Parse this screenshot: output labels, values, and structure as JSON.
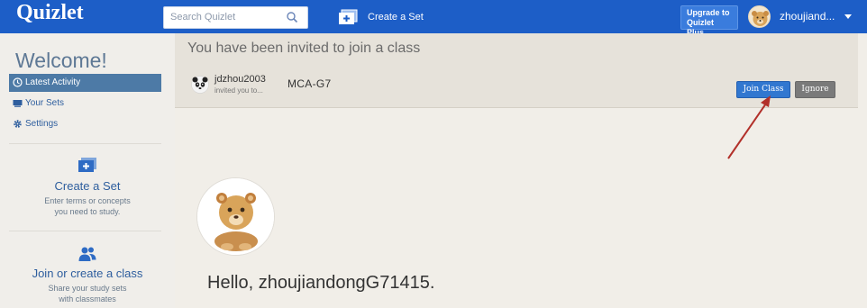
{
  "topbar": {
    "logo": "Quizlet",
    "search_placeholder": "Search Quizlet",
    "create_label": "Create a Set",
    "upgrade_line1": "Upgrade to",
    "upgrade_line2": "Quizlet Plus",
    "username": "zhoujiand...",
    "brand_color": "#1d5ec7"
  },
  "sidebar": {
    "welcome": "Welcome!",
    "nav": [
      {
        "label": "Latest Activity",
        "icon": "clock-icon",
        "active": true
      },
      {
        "label": "Your Sets",
        "icon": "cards-icon",
        "active": false
      },
      {
        "label": "Settings",
        "icon": "gear-icon",
        "active": false
      }
    ],
    "create_set": {
      "title": "Create a Set",
      "desc_line1": "Enter terms or concepts",
      "desc_line2": "you need to study."
    },
    "class_promo": {
      "title": "Join or create a class",
      "desc_line1": "Share your study sets",
      "desc_line2": "with classmates"
    }
  },
  "invite": {
    "title": "You have been invited to join a class",
    "inviter": "jdzhou2003",
    "invited_text": "invited you to...",
    "class_name": "MCA-G7",
    "join_label": "Join Class",
    "ignore_label": "Ignore"
  },
  "profile": {
    "greeting": "Hello, zhoujiandongG71415."
  }
}
